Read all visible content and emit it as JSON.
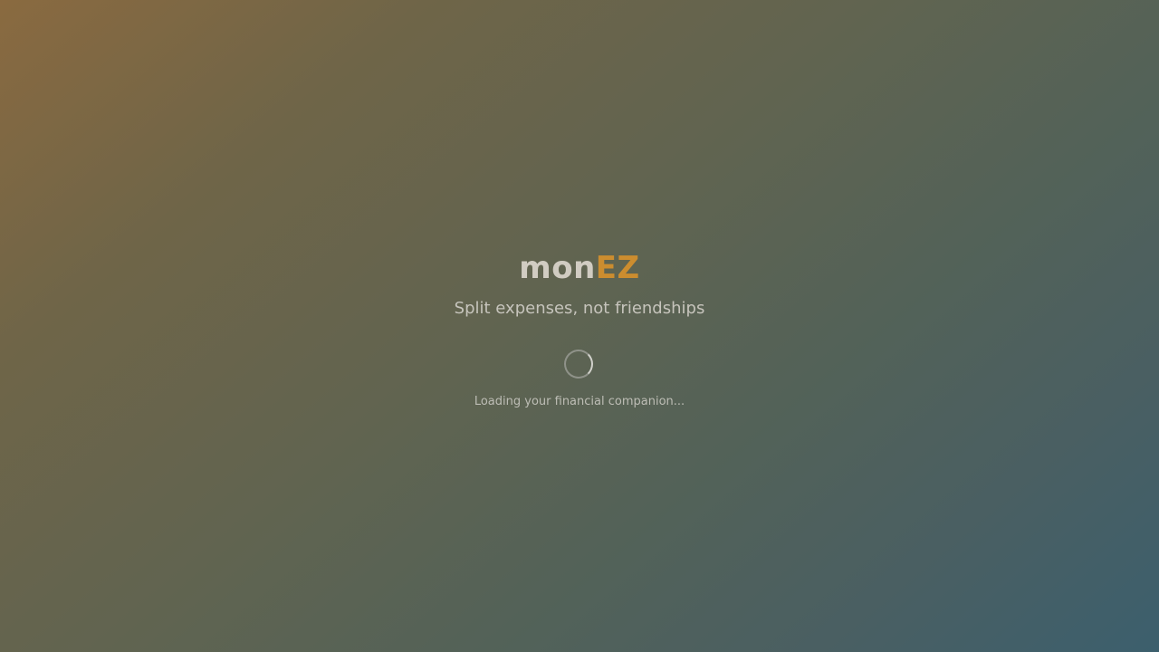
{
  "app": {
    "logo_part_1": "mon",
    "logo_part_2": "EZ",
    "tagline": "Split expenses, not friendships",
    "loading_text": "Loading your financial companion..."
  },
  "theme": {
    "accent": "#cc8d2f",
    "logo_base": "#d1ccc2",
    "gradient_start": "#8a6a40",
    "gradient_end": "#3c5f6d"
  },
  "icons": {
    "spinner": "loading-spinner-icon"
  }
}
